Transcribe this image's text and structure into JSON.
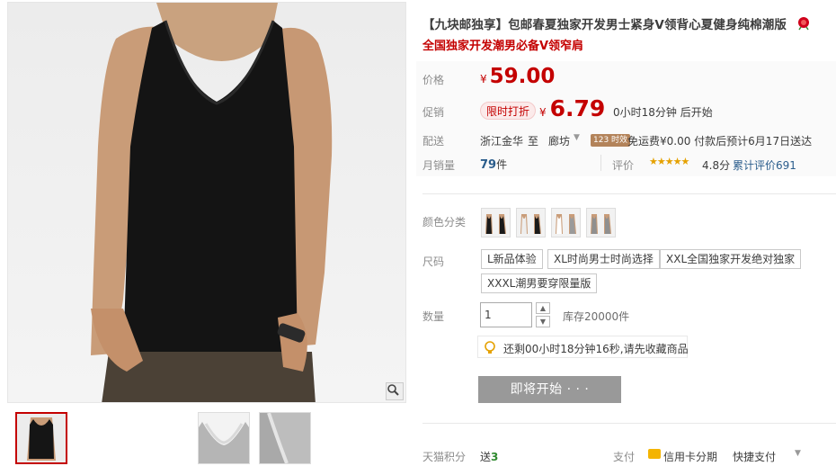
{
  "product": {
    "title": "【九块邮独享】包邮春夏独家开发男士紧身V领背心夏健身纯棉潮版",
    "subtitle": "全国独家开发潮男必备V领窄肩"
  },
  "price": {
    "label": "价格",
    "currency": "¥",
    "original": "59.00"
  },
  "promo": {
    "label": "促销",
    "tag": "限时打折",
    "currency": "¥",
    "price": "6.79",
    "countdown": "0小时18分钟 后开始"
  },
  "shipping": {
    "label": "配送",
    "from": "浙江金华",
    "to_word": "至",
    "to_city": "廊坊",
    "badge": "123 时效",
    "fee_text": "免运费¥0.00 付款后预计6月17日送达"
  },
  "sales": {
    "label": "月销量",
    "count": "79",
    "unit": "件",
    "rating_label": "评价",
    "stars": "★★★★★",
    "score": "4.8分",
    "reviews_text": "累计评价691"
  },
  "color": {
    "label": "颜色分类"
  },
  "size": {
    "label": "尺码",
    "options": [
      "L新品体验",
      "XL时尚男士时尚选择",
      "XXL全国独家开发绝对独家",
      "XXXL潮男要穿限量版"
    ]
  },
  "quantity": {
    "label": "数量",
    "value": "1",
    "stock": "库存20000件"
  },
  "tip": {
    "text": "还剩00小时18分钟16秒,请先收藏商品"
  },
  "buy": {
    "label": "即将开始 · · ·"
  },
  "footer": {
    "points_label": "天猫积分",
    "points_prefix": "送",
    "points_value": "3",
    "pay_label": "支付",
    "credit_text": "信用卡分期",
    "quick_pay": "快捷支付"
  },
  "icons": {
    "zoom": "magnifier-icon",
    "title_badge": "rose-icon",
    "tip": "lightbulb-icon"
  },
  "colors": {
    "accent_red": "#c40000",
    "link_blue": "#2b5d8c",
    "star_gold": "#e5a100",
    "button_disabled": "#999999"
  }
}
